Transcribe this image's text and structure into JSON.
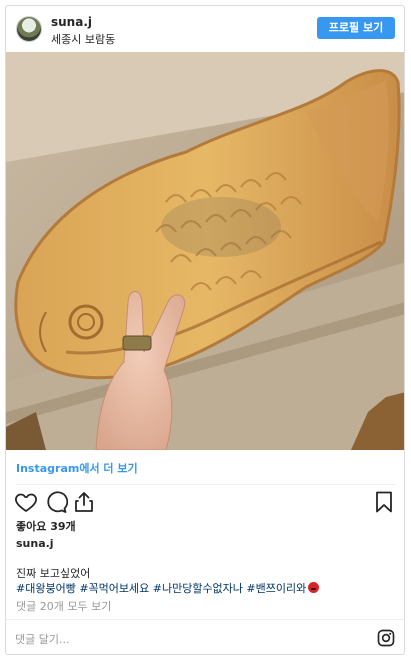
{
  "header": {
    "username": "suna.j",
    "location": "세종시 보람동",
    "profile_button": "프로필 보기"
  },
  "photo": {
    "subject": "giant-fish-bread-in-box",
    "icon": "photo"
  },
  "view_more_link": "Instagram에서 더 보기",
  "actions": {
    "like_icon": "heart-icon",
    "comment_icon": "comment-icon",
    "share_icon": "share-icon",
    "save_icon": "bookmark-icon"
  },
  "likes_text": "좋아요 39개",
  "caption": {
    "username": "suna.j",
    "text": "진짜 보고싶었어",
    "hashtags": "#대왕붕어빵 #꼭먹어보세요 #나만당할수없자나 #밴쯔이리와"
  },
  "comments_link": "댓글 20개 모두 보기",
  "comment_input": {
    "placeholder": "댓글 달기..."
  },
  "colors": {
    "accent": "#3897f0",
    "text": "#262626",
    "muted": "#999999",
    "hashtag": "#003569",
    "border": "#dbdbdb"
  }
}
